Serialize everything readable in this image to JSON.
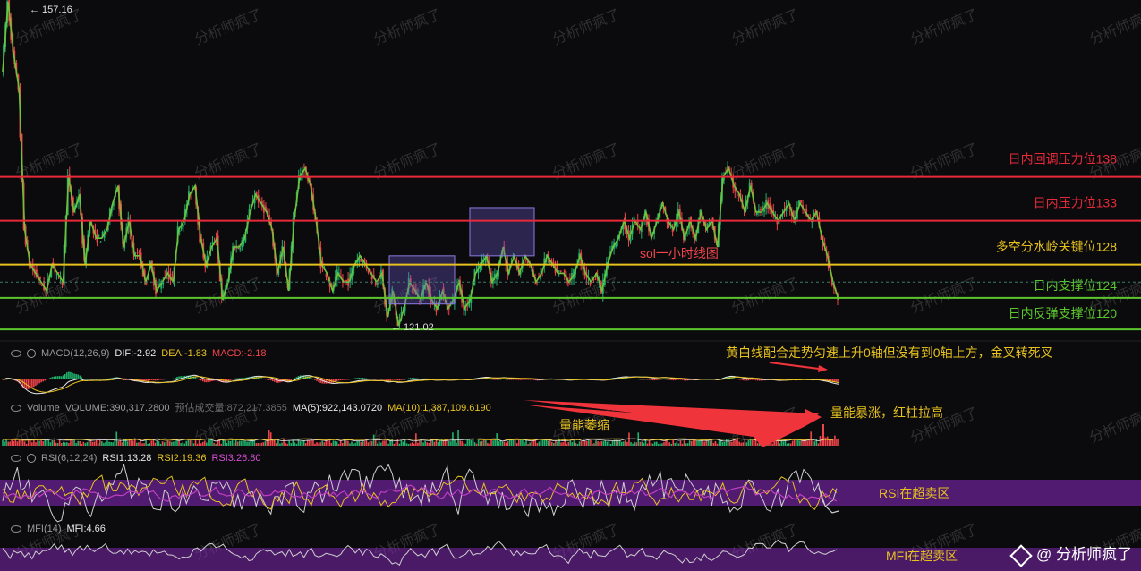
{
  "chart_data": {
    "type": "line",
    "title": "sol一小时线图",
    "watermark": "分析师疯了",
    "price_high": "157.16",
    "price_low": "121.02",
    "ylim": [
      115,
      159
    ],
    "price_series": [
      150,
      158,
      152,
      148,
      132,
      128,
      127,
      126,
      125,
      128,
      127,
      126,
      138,
      134,
      136,
      128,
      133,
      131,
      131,
      132,
      135,
      137,
      130,
      133,
      129,
      129,
      126,
      128,
      125,
      126,
      127,
      126,
      132,
      133,
      136,
      137,
      131,
      128,
      130,
      131,
      124,
      126,
      130,
      130,
      131,
      134,
      136,
      135,
      134,
      132,
      127,
      130,
      125,
      133,
      138,
      139,
      137,
      133,
      128,
      127,
      125,
      127,
      126,
      126,
      128,
      129,
      128,
      127,
      126,
      127,
      122,
      125,
      121,
      123,
      126,
      125,
      124,
      126,
      124,
      123,
      125,
      123,
      124,
      126,
      123,
      124,
      127,
      128,
      129,
      126,
      127,
      130,
      127,
      129,
      127,
      129,
      128,
      126,
      127,
      129,
      128,
      127,
      127,
      126,
      127,
      129,
      127,
      126,
      127,
      125,
      128,
      130,
      131,
      133,
      131,
      133,
      132,
      134,
      131,
      133,
      135,
      133,
      132,
      134,
      131,
      133,
      131,
      134,
      132,
      133,
      130,
      138,
      139,
      137,
      136,
      134,
      137,
      134,
      134,
      135,
      134,
      133,
      134,
      135,
      133,
      135,
      134,
      133,
      134,
      131,
      129,
      126,
      124
    ],
    "price_x_range": [
      3,
      937
    ],
    "levels": [
      {
        "label": "日内回调压力位138",
        "value": 138,
        "color": "#e8293a"
      },
      {
        "label": "日内压力位133",
        "value": 133,
        "color": "#e8293a"
      },
      {
        "label": "多空分水岭关键位128",
        "value": 128,
        "color": "#e7c21f"
      },
      {
        "label": "日内支撑位124",
        "value": 124.2,
        "color": "#5cc62d"
      },
      {
        "label": "日内反弹支撑位120",
        "value": 120.6,
        "color": "#5cc62d"
      }
    ],
    "highlight_boxes": [
      {
        "x_start": 435,
        "x_end": 508,
        "y_top": 129,
        "y_bottom": 123.5
      },
      {
        "x_start": 525,
        "x_end": 597,
        "y_top": 134.5,
        "y_bottom": 129
      }
    ],
    "annotations": [
      "黄白线配合走势匀速上升0轴但没有到0轴上方，金叉转死叉",
      "量能萎缩",
      "量能暴涨，红柱拉高",
      "RSI在超卖区",
      "MFI在超卖区"
    ],
    "macd": {
      "label": "MACD(12,26,9)",
      "dif": "DIF:-2.92",
      "dea": "DEA:-1.83",
      "macd": "MACD:-2.18"
    },
    "volume": {
      "label": "Volume",
      "volume": "VOLUME:390,317.2800",
      "estimate": "预估成交量:872,217.3855",
      "ma5": "MA(5):922,143.0720",
      "ma10": "MA(10):1,387,109.6190"
    },
    "rsi": {
      "label": "RSI(6,12,24)",
      "rsi1": "RSI1:13.28",
      "rsi2": "RSI2:19.36",
      "rsi3": "RSI3:26.80"
    },
    "mfi": {
      "label": "MFI(14)",
      "mfi": "MFI:4.66"
    }
  },
  "credit": "@ 分析师疯了",
  "colors": {
    "up": "#20b26c",
    "down": "#ef454a",
    "trend": "#6fc23a",
    "yellow": "#e7c21f",
    "white": "#e8e8e8",
    "purple": "#8a2ac2"
  }
}
